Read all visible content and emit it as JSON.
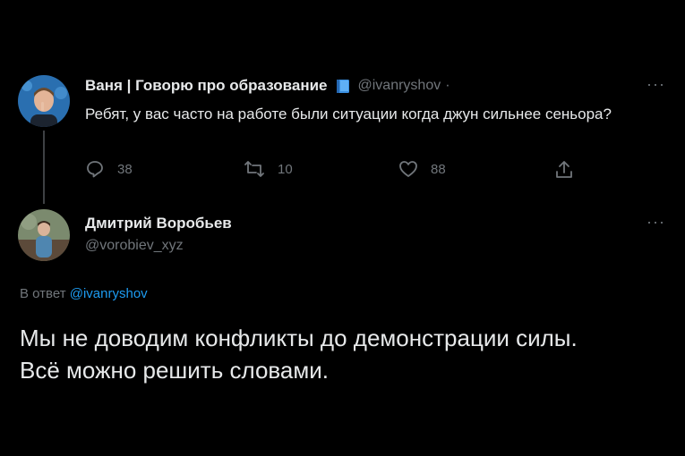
{
  "original_tweet": {
    "author_name": "Ваня | Говорю про образование",
    "author_handle": "@ivanryshov",
    "separator": "·",
    "text": "Ребят, у вас часто на работе были ситуации когда джун сильнее сеньора?",
    "more_label": "···",
    "badge_icon": "blue-book-icon",
    "actions": {
      "reply_count": "38",
      "retweet_count": "10",
      "like_count": "88"
    }
  },
  "reply_tweet": {
    "author_name": "Дмитрий Воробьев",
    "author_handle": "@vorobiev_xyz",
    "more_label": "···",
    "reply_to_prefix": "В ответ",
    "reply_to_handle": "@ivanryshov",
    "text_line1": "Мы не доводим конфликты до демонстрации силы.",
    "text_line2": "Всё можно решить словами."
  },
  "colors": {
    "background": "#000000",
    "text": "#e7e9ea",
    "secondary": "#71767b",
    "link": "#1d9bf0"
  }
}
